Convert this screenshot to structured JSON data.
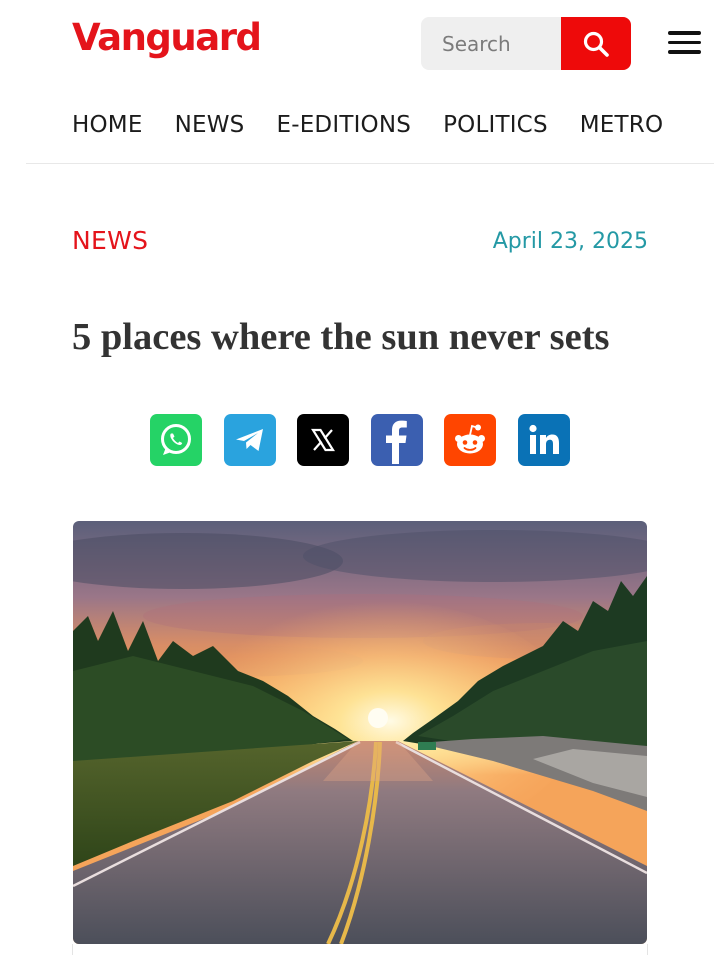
{
  "header": {
    "logo_text": "Vanguard",
    "brand_color": "#e4141b",
    "search": {
      "placeholder": "Search",
      "button_icon": "search-icon",
      "button_color": "#ee0a0a"
    },
    "menu_icon": "hamburger-menu-icon"
  },
  "nav": {
    "items": [
      {
        "label": "HOME"
      },
      {
        "label": "NEWS"
      },
      {
        "label": "E-EDITIONS"
      },
      {
        "label": "POLITICS"
      },
      {
        "label": "METRO"
      }
    ]
  },
  "article": {
    "category": "NEWS",
    "date": "April 23, 2025",
    "date_color": "#2499a5",
    "title": "5 places where the sun never sets",
    "share_buttons": [
      {
        "network": "whatsapp",
        "icon": "whatsapp-icon",
        "color": "#25d366"
      },
      {
        "network": "telegram",
        "icon": "telegram-icon",
        "color": "#2aa3de"
      },
      {
        "network": "x",
        "icon": "x-icon",
        "color": "#000000"
      },
      {
        "network": "facebook",
        "icon": "facebook-icon",
        "color": "#3b5fb0"
      },
      {
        "network": "reddit",
        "icon": "reddit-icon",
        "color": "#ff4500"
      },
      {
        "network": "linkedin",
        "icon": "linkedin-icon",
        "color": "#0a72b6"
      }
    ],
    "hero_image": "sunset over a tree-lined highway"
  }
}
